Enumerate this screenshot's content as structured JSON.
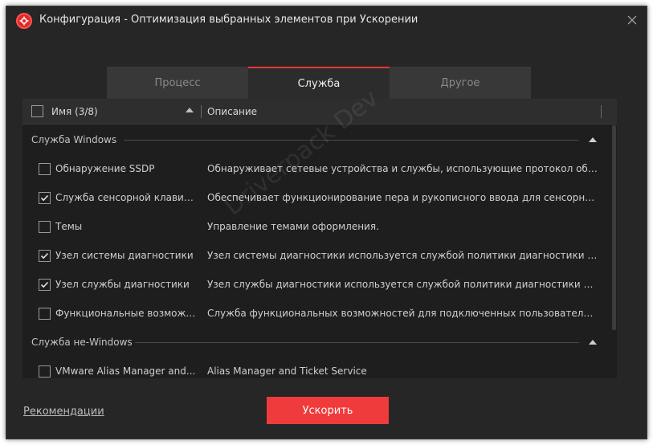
{
  "window": {
    "title": "Конфигурация - Оптимизация выбранных элементов при Ускорении"
  },
  "tabs": [
    {
      "label": "Процесс",
      "active": false
    },
    {
      "label": "Служба",
      "active": true
    },
    {
      "label": "Другое",
      "active": false
    }
  ],
  "columns": {
    "name": "Имя (3/8)",
    "description": "Описание"
  },
  "groups": [
    {
      "label": "Служба Windows",
      "items": [
        {
          "name": "Обнаружение SSDP",
          "description": "Обнаруживает сетевые устройства и службы, использующие протокол обнару...",
          "checked": false
        },
        {
          "name": "Служба сенсорной клавиат...",
          "description": "Обеспечивает функционирование пера и рукописного ввода для сенсорной к...",
          "checked": true
        },
        {
          "name": "Темы",
          "description": "Управление темами оформления.",
          "checked": false
        },
        {
          "name": "Узел системы диагностики",
          "description": "Узел системы диагностики используется службой политики диагностики для ра...",
          "checked": true
        },
        {
          "name": "Узел службы диагностики",
          "description": "Узел службы диагностики используется службой политики диагностики для раз...",
          "checked": true
        },
        {
          "name": "Функциональные возможн...",
          "description": "Служба функциональных возможностей для подключенных пользователей и т...",
          "checked": false
        }
      ]
    },
    {
      "label": "Служба не-Windows",
      "items": [
        {
          "name": "VMware Alias Manager and...",
          "description": "Alias Manager and Ticket Service",
          "checked": false
        }
      ]
    }
  ],
  "watermark": "Driverpack Dev",
  "footer": {
    "recommendations_link": "Рекомендации",
    "accelerate_button": "Ускорить"
  },
  "colors": {
    "accent": "#ef3b3b",
    "background": "#262626",
    "panel": "#1e1e1e"
  }
}
